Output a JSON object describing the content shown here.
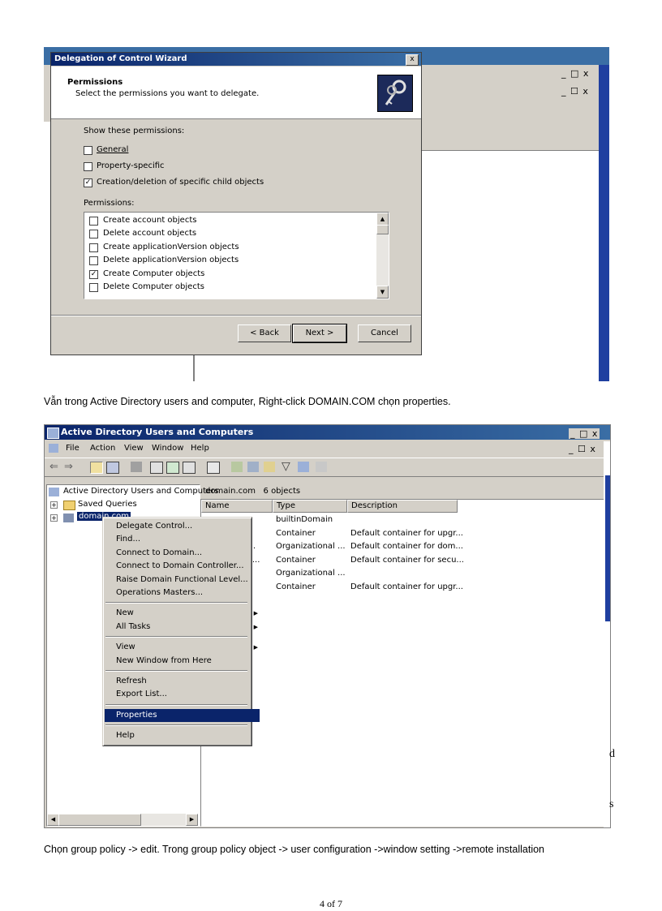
{
  "wizard": {
    "bg_window_controls_1": "_ □ x",
    "bg_window_controls_2": "_ ☐ x",
    "title": "Delegation of Control Wizard",
    "close": "x",
    "header_title": "Permissions",
    "header_subtitle": "Select the permissions you want to delegate.",
    "show_label": "Show these permissions:",
    "filters": [
      {
        "label": "General",
        "checked": false
      },
      {
        "label": "Property-specific",
        "checked": false
      },
      {
        "label": "Creation/deletion of specific child objects",
        "checked": true
      }
    ],
    "permissions_label": "Permissions:",
    "permissions": [
      {
        "label": "Create account objects",
        "checked": false
      },
      {
        "label": "Delete account objects",
        "checked": false
      },
      {
        "label": "Create applicationVersion objects",
        "checked": false
      },
      {
        "label": "Delete applicationVersion objects",
        "checked": false
      },
      {
        "label": "Create Computer objects",
        "checked": true
      },
      {
        "label": "Delete Computer objects",
        "checked": false
      }
    ],
    "back": "< Back",
    "next": "Next >",
    "cancel": "Cancel"
  },
  "caption1": "Vẫn trong Active Directory users and computer, Right-click DOMAIN.COM chọn properties.",
  "aduc": {
    "title": "Active Directory Users and Computers",
    "win_controls": "_ □ x",
    "inner_controls": "_ ☐ x",
    "menu": [
      "File",
      "Action",
      "View",
      "Window",
      "Help"
    ],
    "tree_root": "Active Directory Users and Computers",
    "tree_items": [
      "Saved Queries",
      "domain.com"
    ],
    "right_header": "domain.com   6 objects",
    "columns": [
      "Name",
      "Type",
      "Description"
    ],
    "rows": [
      {
        "name": "",
        "type": "builtinDomain",
        "desc": ""
      },
      {
        "name": "s",
        "type": "Container",
        "desc": "Default container for upgr..."
      },
      {
        "name": "ontr...",
        "type": "Organizational ...",
        "desc": "Default container for dom..."
      },
      {
        "name": "ecuri...",
        "type": "Container",
        "desc": "Default container for secu..."
      },
      {
        "name": "",
        "type": "Organizational ...",
        "desc": ""
      },
      {
        "name": "",
        "type": "Container",
        "desc": "Default container for upgr..."
      }
    ],
    "context_menu": [
      {
        "label": "Delegate Control...",
        "sub": false
      },
      {
        "label": "Find...",
        "sub": false
      },
      {
        "label": "Connect to Domain...",
        "sub": false
      },
      {
        "label": "Connect to Domain Controller...",
        "sub": false
      },
      {
        "label": "Raise Domain Functional Level...",
        "sub": false
      },
      {
        "label": "Operations Masters...",
        "sub": false
      },
      {
        "label": "New",
        "sub": true
      },
      {
        "label": "All Tasks",
        "sub": true
      },
      {
        "label": "View",
        "sub": true
      },
      {
        "label": "New Window from Here",
        "sub": false
      },
      {
        "label": "Refresh",
        "sub": false
      },
      {
        "label": "Export List...",
        "sub": false
      },
      {
        "label": "Properties",
        "sub": false,
        "selected": true
      },
      {
        "label": "Help",
        "sub": false
      }
    ],
    "edge_letters": [
      "d",
      "s"
    ]
  },
  "caption2": "Chọn group policy -> edit. Trong group policy object -> user configuration ->window setting ->remote installation",
  "footer": "4 of 7"
}
